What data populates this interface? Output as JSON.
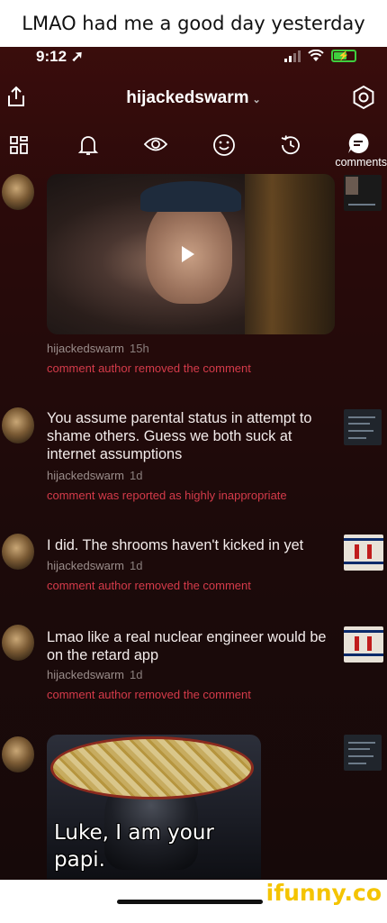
{
  "caption": "LMAO had me a good day yesterday",
  "status_bar": {
    "time": "9:12"
  },
  "header": {
    "username": "hijackedswarm",
    "caret": "⌄"
  },
  "tabs": {
    "active_label": "comments"
  },
  "comments": [
    {
      "author": "hijackedswarm",
      "age": "15h",
      "status": "comment author removed the comment"
    },
    {
      "text": "You assume parental status in attempt to shame others. Guess we both suck at internet assumptions",
      "author": "hijackedswarm",
      "age": "1d",
      "status": "comment was reported as highly inappropriate"
    },
    {
      "text": "I did. The shrooms haven't kicked in yet",
      "author": "hijackedswarm",
      "age": "1d",
      "status": "comment author removed the comment"
    },
    {
      "text": "Lmao like a real nuclear engineer would be on the retard app",
      "author": "hijackedswarm",
      "age": "1d",
      "status": "comment author removed the comment"
    },
    {
      "meme_line1": "Luke, I am your",
      "meme_line2": "papi."
    }
  ],
  "watermark": "ifunny.co",
  "colors": {
    "accent": "#d53b4a",
    "background": "#1d0a0a",
    "watermark": "#f4c400"
  }
}
